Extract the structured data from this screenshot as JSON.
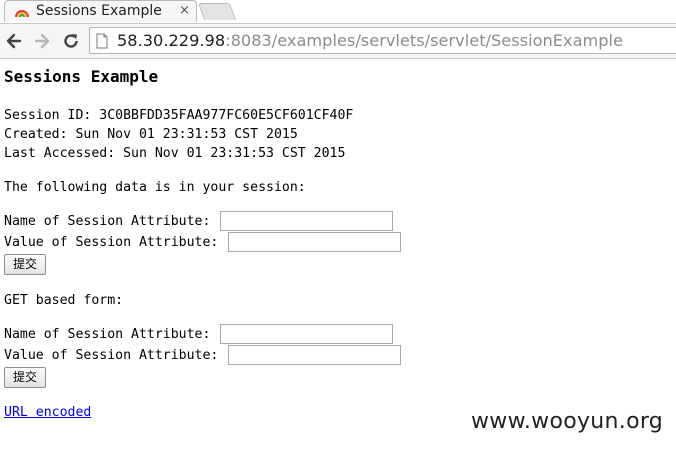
{
  "browser": {
    "tab_title": "Sessions Example",
    "tab_close": "×",
    "url_host": "58.30.229.98",
    "url_rest": ":8083/examples/servlets/servlet/SessionExample"
  },
  "page": {
    "heading": "Sessions Example",
    "session_id": "Session ID: 3C0BBFDD35FAA977FC60E5CF601CF40F",
    "created": "Created: Sun Nov 01 23:31:53 CST 2015",
    "last_accessed": "Last Accessed: Sun Nov 01 23:31:53 CST 2015",
    "data_intro": "The following data is in your session:",
    "post_form": {
      "name_label": "Name of Session Attribute:",
      "value_label": "Value of Session Attribute:",
      "name_value": "",
      "value_value": "",
      "submit_label": "提交"
    },
    "get_form_title": "GET based form:",
    "get_form": {
      "name_label": "Name of Session Attribute:",
      "value_label": "Value of Session Attribute:",
      "name_value": "",
      "value_value": "",
      "submit_label": "提交"
    },
    "url_encoded_link": "URL encoded"
  },
  "watermark": "www.wooyun.org"
}
